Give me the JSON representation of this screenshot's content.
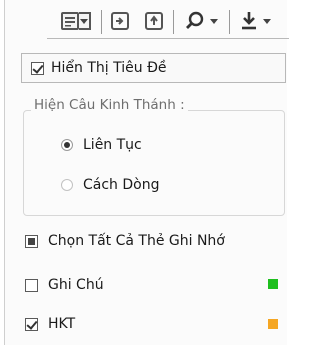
{
  "toolbar": {
    "buttons": [
      {
        "icon": "list-view-icon",
        "has_dropdown": true
      },
      {
        "icon": "collapse-icon",
        "has_dropdown": false
      },
      {
        "icon": "expand-icon",
        "has_dropdown": false
      },
      {
        "icon": "search-icon",
        "has_dropdown": true
      },
      {
        "icon": "download-icon",
        "has_dropdown": true
      }
    ]
  },
  "show_title": {
    "label": "Hiển Thị Tiêu Đề",
    "checked": true
  },
  "verse_display": {
    "title": "Hiện Câu Kinh Thánh :",
    "options": [
      {
        "label": "Liên Tục",
        "selected": true
      },
      {
        "label": "Cách Dòng",
        "selected": false
      }
    ]
  },
  "select_all": {
    "label": "Chọn Tất Cả Thẻ Ghi Nhớ",
    "state": "indeterminate"
  },
  "tags": [
    {
      "label": "Ghi Chú",
      "checked": false,
      "color": "#1fbf1f"
    },
    {
      "label": "HKT",
      "checked": true,
      "color": "#f5a623"
    }
  ]
}
